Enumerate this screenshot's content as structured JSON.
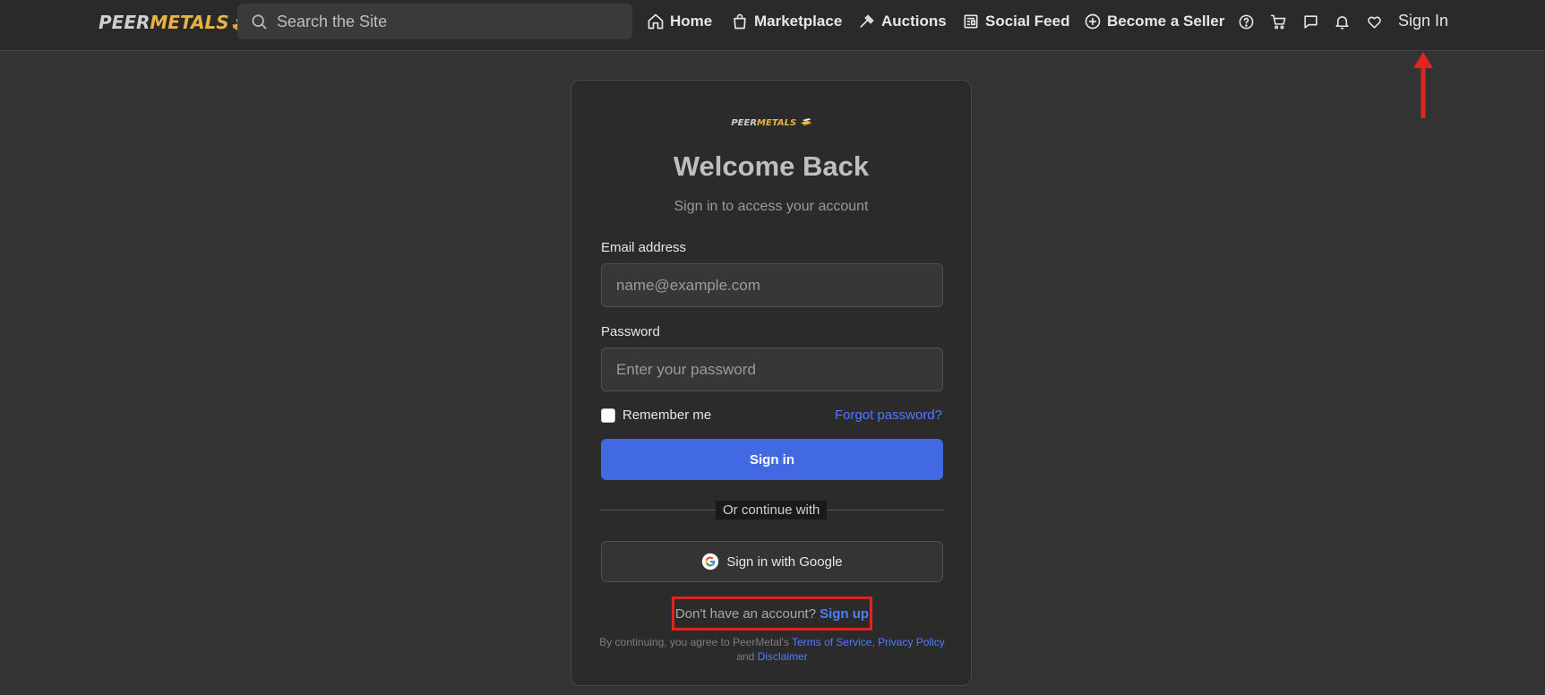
{
  "header": {
    "logo": {
      "part1": "PEER",
      "part2": "METALS"
    },
    "search_placeholder": "Search the Site",
    "nav": [
      {
        "label": "Home",
        "icon": "home-icon"
      },
      {
        "label": "Marketplace",
        "icon": "shopping-bag-icon"
      },
      {
        "label": "Auctions",
        "icon": "gavel-icon"
      },
      {
        "label": "Social Feed",
        "icon": "newspaper-icon"
      },
      {
        "label": "Become a Seller",
        "icon": "plus-circle-icon"
      }
    ],
    "icons": [
      "help-icon",
      "cart-icon",
      "chat-icon",
      "bell-icon",
      "heart-icon"
    ],
    "sign_in": "Sign In"
  },
  "card": {
    "logo": {
      "part1": "PEER",
      "part2": "METALS"
    },
    "title": "Welcome Back",
    "subtitle": "Sign in to access your account",
    "email": {
      "label": "Email address",
      "placeholder": "name@example.com",
      "value": ""
    },
    "password": {
      "label": "Password",
      "placeholder": "Enter your password",
      "value": ""
    },
    "remember": "Remember me",
    "forgot": "Forgot password?",
    "submit": "Sign in",
    "divider": "Or continue with",
    "google": "Sign in with Google",
    "signup": {
      "prompt": "Don't have an account?",
      "link": "Sign up"
    },
    "legal": {
      "prefix": "By continuing, you agree to PeerMetal's ",
      "terms": "Terms of Service",
      "comma": ", ",
      "privacy": "Privacy Policy",
      "and": " and ",
      "disclaimer": "Disclaimer"
    }
  },
  "colors": {
    "accent": "#4169e1",
    "link": "#4f7bff",
    "gold": "#e8b341",
    "annotation": "#e02424"
  }
}
